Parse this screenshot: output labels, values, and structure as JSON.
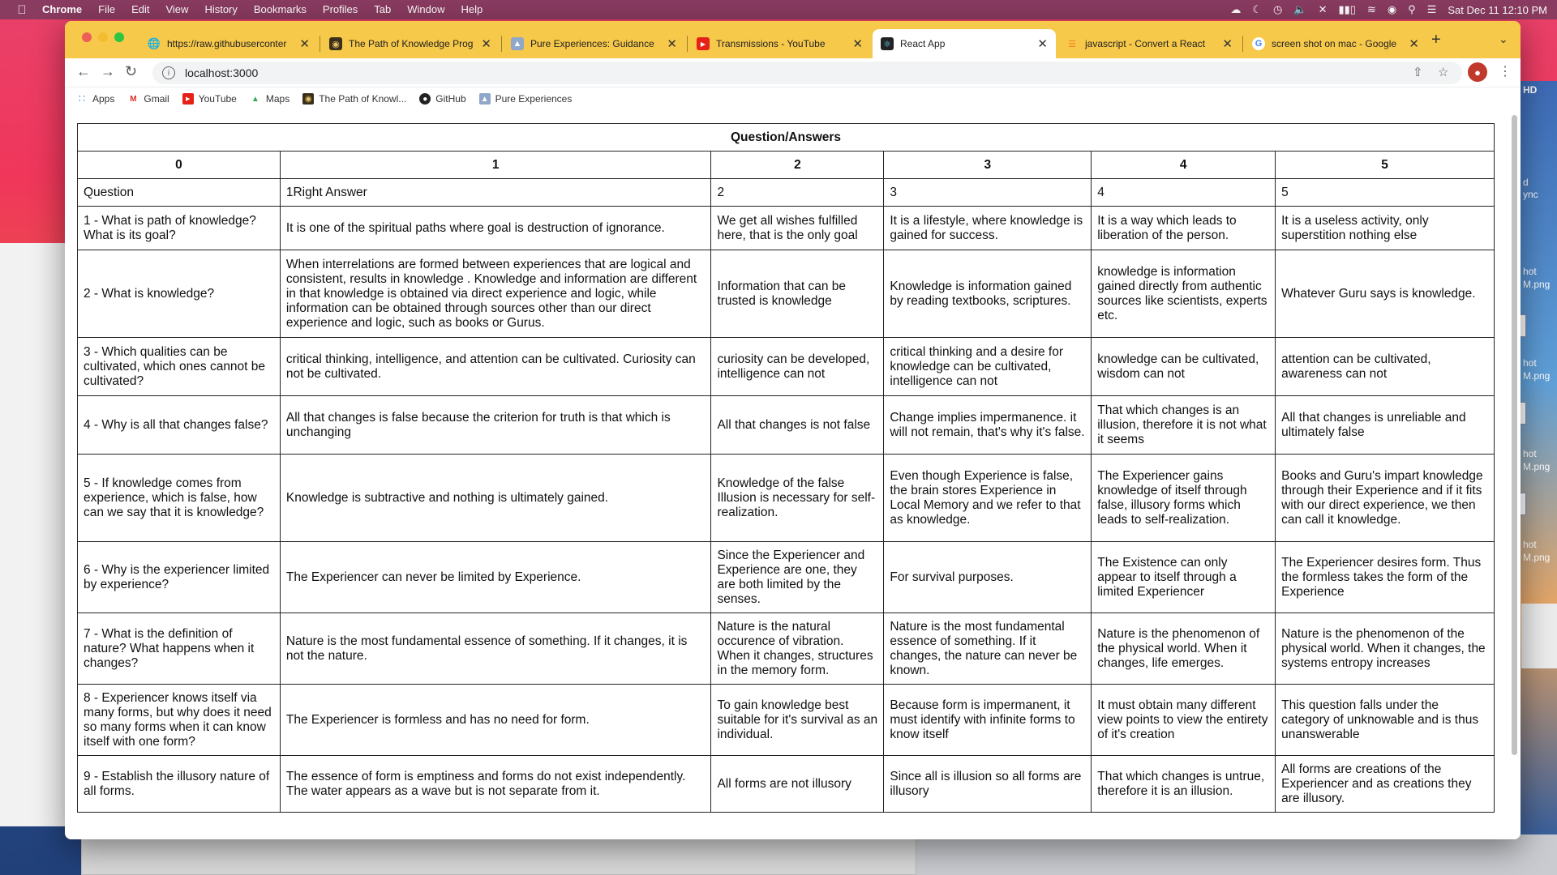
{
  "menubar": {
    "app": "Chrome",
    "menus": [
      "File",
      "Edit",
      "View",
      "History",
      "Bookmarks",
      "Profiles",
      "Tab",
      "Window",
      "Help"
    ],
    "datetime": "Sat Dec 11  12:10 PM"
  },
  "desktop": {
    "labels": [
      "HD",
      "d",
      "ync",
      "hot",
      "M.png",
      "hot",
      "M.png",
      "hot",
      "M.png",
      "hot",
      "M.png"
    ]
  },
  "tabs": [
    {
      "title": "https://raw.githubuserconter",
      "icon": "globe-icon"
    },
    {
      "title": "The Path of Knowledge Prog",
      "icon": "book-icon"
    },
    {
      "title": "Pure Experiences: Guidance",
      "icon": "image-icon"
    },
    {
      "title": "Transmissions - YouTube",
      "icon": "youtube-icon"
    },
    {
      "title": "React App",
      "icon": "react-icon"
    },
    {
      "title": "javascript - Convert a React",
      "icon": "stackoverflow-icon"
    },
    {
      "title": "screen shot on mac - Google",
      "icon": "google-icon"
    }
  ],
  "address": {
    "url": "localhost:3000"
  },
  "bookmarks": [
    {
      "label": "Apps",
      "icon": "apps-grid-icon"
    },
    {
      "label": "Gmail",
      "icon": "gmail-icon"
    },
    {
      "label": "YouTube",
      "icon": "youtube-icon"
    },
    {
      "label": "Maps",
      "icon": "maps-icon"
    },
    {
      "label": "The Path of Knowl...",
      "icon": "book-icon"
    },
    {
      "label": "GitHub",
      "icon": "github-icon"
    },
    {
      "label": "Pure Experiences",
      "icon": "image-icon"
    }
  ],
  "table": {
    "caption": "Question/Answers",
    "headers": [
      "0",
      "1",
      "2",
      "3",
      "4",
      "5"
    ],
    "rows": [
      [
        "Question",
        "1Right Answer",
        "2",
        "3",
        "4",
        "5"
      ],
      [
        "1 - What is path of knowledge? What is its goal?",
        "It is one of the spiritual paths where goal is destruction of ignorance.",
        "We get all wishes fulfilled here, that is the only goal",
        "It is a lifestyle, where knowledge is gained for success.",
        "It is a way which leads to liberation of the person.",
        "It is a useless activity, only superstition nothing else"
      ],
      [
        "2 - What is knowledge?",
        "When interrelations are formed between experiences that are logical and consistent, results in knowledge . Knowledge and information are different in that knowledge is obtained via direct experience and logic, while information can be obtained through sources other than our direct experience and logic, such as books or Gurus.",
        "Information that can be trusted is knowledge",
        "Knowledge is information gained by reading textbooks, scriptures.",
        "knowledge is information gained directly from authentic sources like scientists, experts etc.",
        "Whatever Guru says is knowledge."
      ],
      [
        "3 - Which qualities can be cultivated, which ones cannot be cultivated?",
        "critical thinking, intelligence, and attention can be cultivated. Curiosity can not be cultivated.",
        "curiosity can be developed, intelligence can not",
        "critical thinking and a desire for knowledge can be cultivated, intelligence can not",
        "knowledge can be cultivated, wisdom can not",
        "attention can be cultivated, awareness can not"
      ],
      [
        "4 - Why is all that changes false?",
        "All that changes is false because the criterion for truth is that which is unchanging",
        "All that changes is not false",
        "Change implies impermanence. it will not remain, that's why it's false.",
        "That which changes is an illusion, therefore it is not what it seems",
        "All that changes is unreliable and ultimately false"
      ],
      [
        "5 - If knowledge comes from experience, which is false, how can we say that it is knowledge?",
        "Knowledge is subtractive and nothing is ultimately gained.",
        "Knowledge of the false Illusion is necessary for self-realization.",
        "Even though Experience is false, the brain stores Experience in Local Memory and we refer to that as knowledge.",
        "The Experiencer gains knowledge of itself through false, illusory forms which leads to self-realization.",
        "Books and Guru's impart knowledge through their Experience and if it fits with our direct experience, we then can call it knowledge."
      ],
      [
        "6 - Why is the experiencer limited by experience?",
        "The Experiencer can never be limited by Experience.",
        "Since the Experiencer and Experience are one, they are both limited by the senses.",
        "For survival purposes.",
        "The Existence can only appear to itself through a limited Experiencer",
        "The Experiencer desires form. Thus the formless takes the form of the Experience"
      ],
      [
        "7 - What is the definition of nature? What happens when it changes?",
        "Nature is the most fundamental essence of something. If it changes, it is not the nature.",
        "Nature is the natural occurence of vibration. When it changes, structures in the memory form.",
        "Nature is the most fundamental essence of something. If it changes, the nature can never be known.",
        "Nature is the phenomenon of the physical world. When it changes, life emerges.",
        "Nature is the phenomenon of the physical world. When it changes, the systems entropy increases"
      ],
      [
        "8 - Experiencer knows itself via many forms, but why does it need so many forms when it can know itself with one form?",
        "The Experiencer is formless and has no need for form.",
        "To gain knowledge best suitable for it's survival as an individual.",
        "Because form is impermanent, it must identify with infinite forms to know itself",
        "It must obtain many different view points to view the entirety of it's creation",
        "This question falls under the category of unknowable and is thus unanswerable"
      ],
      [
        "9 - Establish the illusory nature of all forms.",
        "The essence of form is emptiness and forms do not exist independently. The water appears as a wave but is not separate from it.",
        "All forms are not illusory",
        "Since all is illusion so all forms are illusory",
        "That which changes is untrue, therefore it is an illusion.",
        "All forms are creations of the Experiencer and as creations they are illusory."
      ]
    ]
  }
}
